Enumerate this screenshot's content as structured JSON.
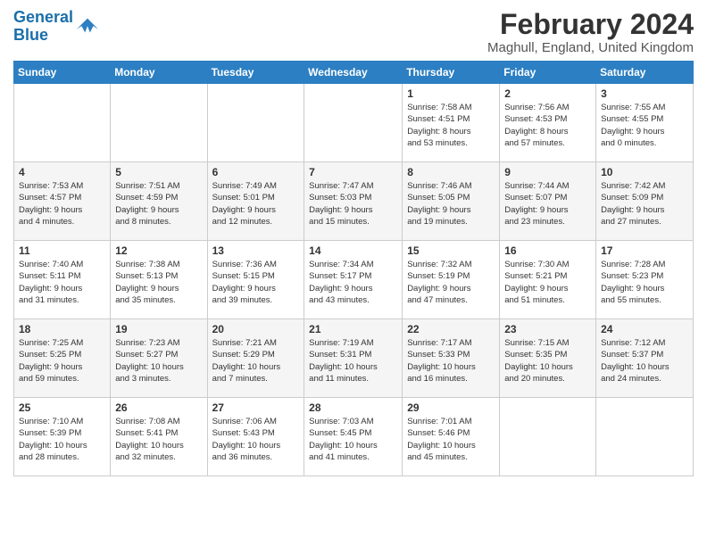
{
  "header": {
    "logo": {
      "line1": "General",
      "line2": "Blue"
    },
    "title": "February 2024",
    "location": "Maghull, England, United Kingdom"
  },
  "weekdays": [
    "Sunday",
    "Monday",
    "Tuesday",
    "Wednesday",
    "Thursday",
    "Friday",
    "Saturday"
  ],
  "weeks": [
    [
      {
        "day": "",
        "info": ""
      },
      {
        "day": "",
        "info": ""
      },
      {
        "day": "",
        "info": ""
      },
      {
        "day": "",
        "info": ""
      },
      {
        "day": "1",
        "info": "Sunrise: 7:58 AM\nSunset: 4:51 PM\nDaylight: 8 hours\nand 53 minutes."
      },
      {
        "day": "2",
        "info": "Sunrise: 7:56 AM\nSunset: 4:53 PM\nDaylight: 8 hours\nand 57 minutes."
      },
      {
        "day": "3",
        "info": "Sunrise: 7:55 AM\nSunset: 4:55 PM\nDaylight: 9 hours\nand 0 minutes."
      }
    ],
    [
      {
        "day": "4",
        "info": "Sunrise: 7:53 AM\nSunset: 4:57 PM\nDaylight: 9 hours\nand 4 minutes."
      },
      {
        "day": "5",
        "info": "Sunrise: 7:51 AM\nSunset: 4:59 PM\nDaylight: 9 hours\nand 8 minutes."
      },
      {
        "day": "6",
        "info": "Sunrise: 7:49 AM\nSunset: 5:01 PM\nDaylight: 9 hours\nand 12 minutes."
      },
      {
        "day": "7",
        "info": "Sunrise: 7:47 AM\nSunset: 5:03 PM\nDaylight: 9 hours\nand 15 minutes."
      },
      {
        "day": "8",
        "info": "Sunrise: 7:46 AM\nSunset: 5:05 PM\nDaylight: 9 hours\nand 19 minutes."
      },
      {
        "day": "9",
        "info": "Sunrise: 7:44 AM\nSunset: 5:07 PM\nDaylight: 9 hours\nand 23 minutes."
      },
      {
        "day": "10",
        "info": "Sunrise: 7:42 AM\nSunset: 5:09 PM\nDaylight: 9 hours\nand 27 minutes."
      }
    ],
    [
      {
        "day": "11",
        "info": "Sunrise: 7:40 AM\nSunset: 5:11 PM\nDaylight: 9 hours\nand 31 minutes."
      },
      {
        "day": "12",
        "info": "Sunrise: 7:38 AM\nSunset: 5:13 PM\nDaylight: 9 hours\nand 35 minutes."
      },
      {
        "day": "13",
        "info": "Sunrise: 7:36 AM\nSunset: 5:15 PM\nDaylight: 9 hours\nand 39 minutes."
      },
      {
        "day": "14",
        "info": "Sunrise: 7:34 AM\nSunset: 5:17 PM\nDaylight: 9 hours\nand 43 minutes."
      },
      {
        "day": "15",
        "info": "Sunrise: 7:32 AM\nSunset: 5:19 PM\nDaylight: 9 hours\nand 47 minutes."
      },
      {
        "day": "16",
        "info": "Sunrise: 7:30 AM\nSunset: 5:21 PM\nDaylight: 9 hours\nand 51 minutes."
      },
      {
        "day": "17",
        "info": "Sunrise: 7:28 AM\nSunset: 5:23 PM\nDaylight: 9 hours\nand 55 minutes."
      }
    ],
    [
      {
        "day": "18",
        "info": "Sunrise: 7:25 AM\nSunset: 5:25 PM\nDaylight: 9 hours\nand 59 minutes."
      },
      {
        "day": "19",
        "info": "Sunrise: 7:23 AM\nSunset: 5:27 PM\nDaylight: 10 hours\nand 3 minutes."
      },
      {
        "day": "20",
        "info": "Sunrise: 7:21 AM\nSunset: 5:29 PM\nDaylight: 10 hours\nand 7 minutes."
      },
      {
        "day": "21",
        "info": "Sunrise: 7:19 AM\nSunset: 5:31 PM\nDaylight: 10 hours\nand 11 minutes."
      },
      {
        "day": "22",
        "info": "Sunrise: 7:17 AM\nSunset: 5:33 PM\nDaylight: 10 hours\nand 16 minutes."
      },
      {
        "day": "23",
        "info": "Sunrise: 7:15 AM\nSunset: 5:35 PM\nDaylight: 10 hours\nand 20 minutes."
      },
      {
        "day": "24",
        "info": "Sunrise: 7:12 AM\nSunset: 5:37 PM\nDaylight: 10 hours\nand 24 minutes."
      }
    ],
    [
      {
        "day": "25",
        "info": "Sunrise: 7:10 AM\nSunset: 5:39 PM\nDaylight: 10 hours\nand 28 minutes."
      },
      {
        "day": "26",
        "info": "Sunrise: 7:08 AM\nSunset: 5:41 PM\nDaylight: 10 hours\nand 32 minutes."
      },
      {
        "day": "27",
        "info": "Sunrise: 7:06 AM\nSunset: 5:43 PM\nDaylight: 10 hours\nand 36 minutes."
      },
      {
        "day": "28",
        "info": "Sunrise: 7:03 AM\nSunset: 5:45 PM\nDaylight: 10 hours\nand 41 minutes."
      },
      {
        "day": "29",
        "info": "Sunrise: 7:01 AM\nSunset: 5:46 PM\nDaylight: 10 hours\nand 45 minutes."
      },
      {
        "day": "",
        "info": ""
      },
      {
        "day": "",
        "info": ""
      }
    ]
  ]
}
